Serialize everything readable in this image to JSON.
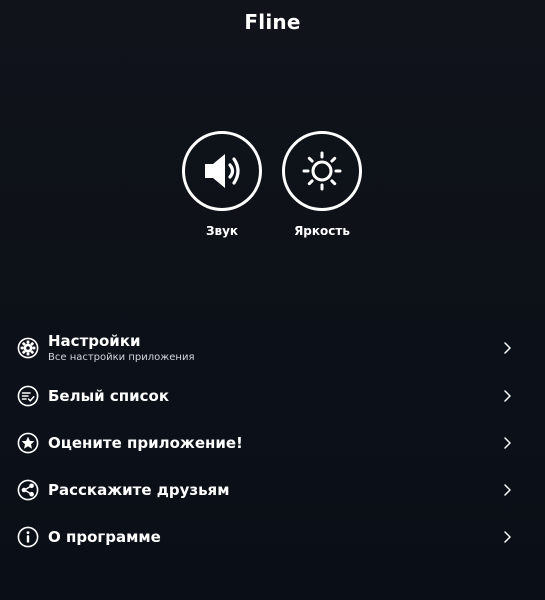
{
  "app": {
    "title": "Fline"
  },
  "toggles": [
    {
      "label": "Звук",
      "icon": "speaker-icon"
    },
    {
      "label": "Яркость",
      "icon": "sun-icon"
    }
  ],
  "menu": [
    {
      "label": "Настройки",
      "sublabel": "Все настройки приложения",
      "icon": "gear-icon"
    },
    {
      "label": "Белый список",
      "sublabel": "",
      "icon": "checklist-icon"
    },
    {
      "label": "Оцените приложение!",
      "sublabel": "",
      "icon": "star-icon"
    },
    {
      "label": "Расскажите друзьям",
      "sublabel": "",
      "icon": "share-icon"
    },
    {
      "label": "О программе",
      "sublabel": "",
      "icon": "info-icon"
    }
  ],
  "colors": {
    "background_top": "#10131a",
    "background_bottom": "#0a0f17",
    "foreground": "#ffffff",
    "sublabel": "#d4d7db"
  }
}
